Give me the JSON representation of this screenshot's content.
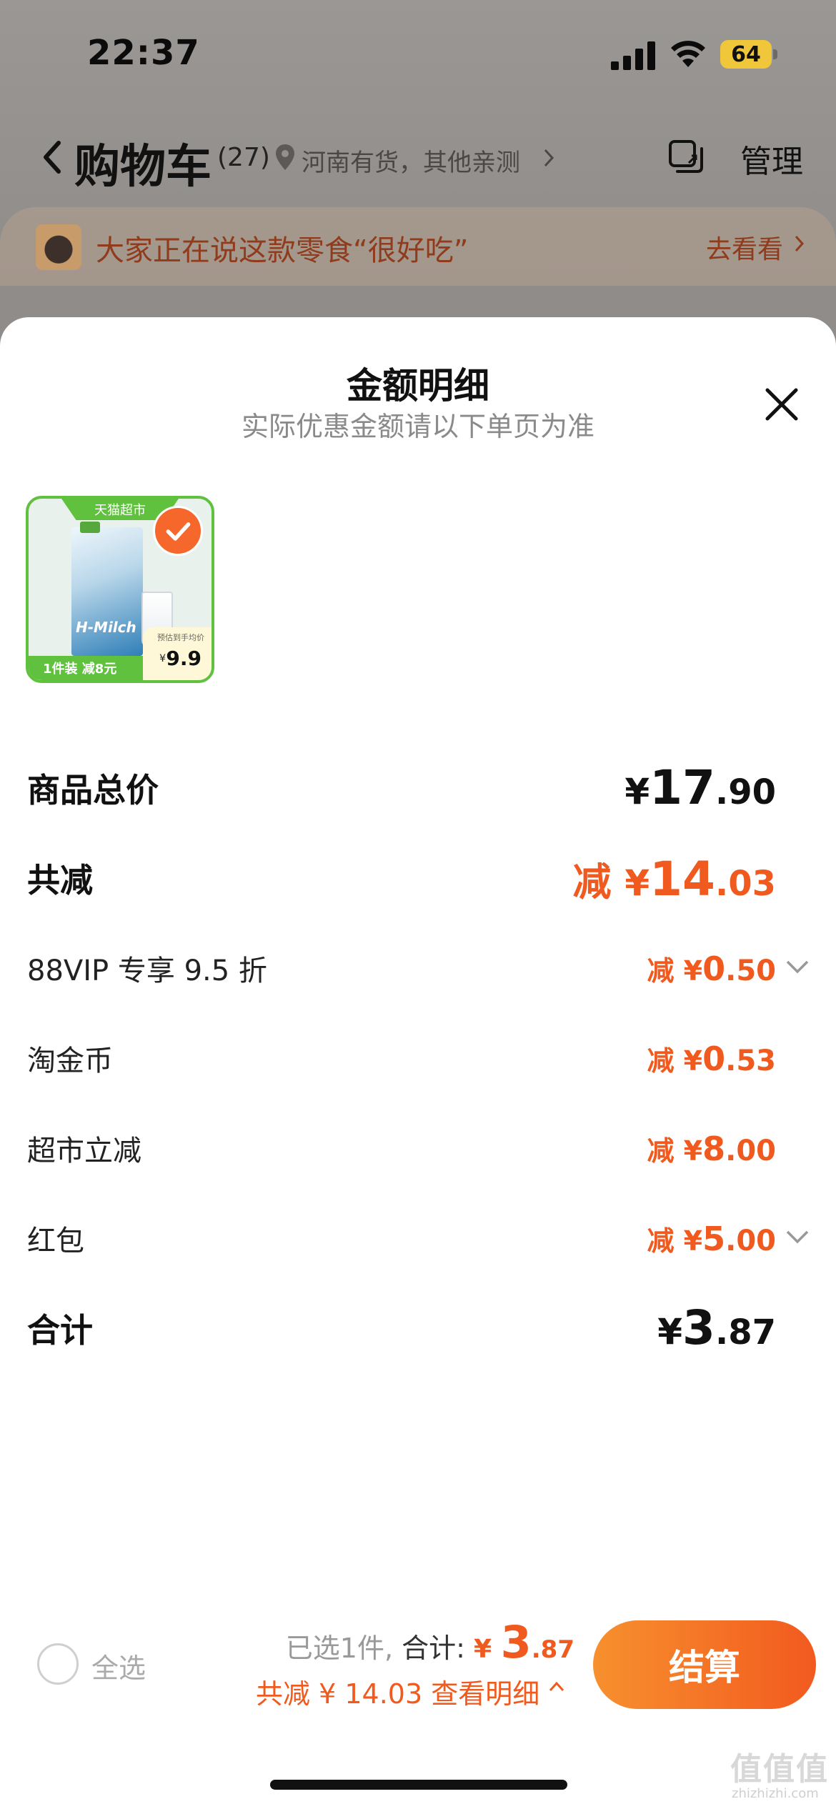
{
  "status_bar": {
    "time": "22:37",
    "battery": "64"
  },
  "nav": {
    "title": "购物车",
    "count": "(27)",
    "location": "河南有货，其他亲测",
    "manage": "管理"
  },
  "banner": {
    "text": "大家正在说这款零食“很好吃”",
    "link": "去看看"
  },
  "sheet": {
    "title": "金额明细",
    "subtitle": "实际优惠金额请以下单页为准",
    "product": {
      "top_tag": "天猫超市",
      "brand_text": "H-Milch",
      "bottom_tag": "1件装 减8元",
      "price_caption": "预估到手均价",
      "price_currency": "¥",
      "price": "9.9"
    },
    "rows": [
      {
        "label": "商品总价",
        "prefix": "",
        "currency": "¥",
        "int": "17",
        "dec": ".90"
      },
      {
        "label": "共减",
        "prefix": "减 ",
        "currency": "¥",
        "int": "14",
        "dec": ".03"
      },
      {
        "label": "88VIP 专享 9.5 折",
        "prefix": "减 ",
        "currency": "¥",
        "int": "0",
        "dec": ".50"
      },
      {
        "label": "淘金币",
        "prefix": "减 ",
        "currency": "¥",
        "int": "0",
        "dec": ".53"
      },
      {
        "label": "超市立减",
        "prefix": "减 ",
        "currency": "¥",
        "int": "8",
        "dec": ".00"
      },
      {
        "label": "红包",
        "prefix": "减 ",
        "currency": "¥",
        "int": "5",
        "dec": ".00"
      },
      {
        "label": "合计",
        "prefix": "",
        "currency": "¥",
        "int": "3",
        "dec": ".87"
      }
    ]
  },
  "bottom_bar": {
    "select_all": "全选",
    "selected_label": "已选1件, ",
    "total_label": "合计: ",
    "total_currency": "¥ ",
    "total_int": "3",
    "total_dec": ".87",
    "discount_text": "共减 ¥ 14.03  查看明细",
    "checkout": "结算"
  },
  "watermark": {
    "logo": "值值值",
    "url": "zhizhizhi.com"
  },
  "colors": {
    "accent": "#f05a1f",
    "button_start": "#f7902e",
    "button_end": "#f25a1f",
    "check_green": "#5fc13e"
  }
}
